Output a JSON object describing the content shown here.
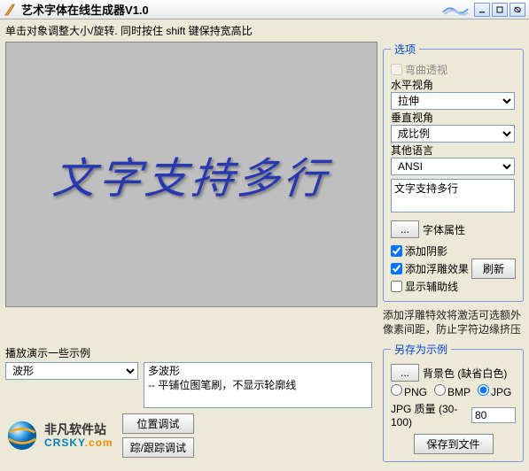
{
  "titlebar": {
    "title": "艺术字体在线生成器V1.0"
  },
  "hint": "单击对象调整大小/旋转.    同时按住 shift 键保持宽高比",
  "canvas": {
    "sample_text": "文字支持多行"
  },
  "options": {
    "legend": "选项",
    "curved_perspective": "弯曲透视",
    "h_label": "水平视角",
    "h_value": "拉伸",
    "v_label": "垂直视角",
    "v_value": "成比例",
    "lang_label": "其他语言",
    "lang_value": "ANSI",
    "text_value": "文字支持多行",
    "font_props_btn": "...",
    "font_props_label": "字体属性",
    "add_shadow": "添加阴影",
    "add_emboss": "添加浮雕效果",
    "refresh": "刷新",
    "show_guides": "显示辅助线",
    "note": "添加浮雕特效将激活可选额外像素间距，防止字符边缘挤压"
  },
  "demo": {
    "label": "播放演示一些示例",
    "select_value": "波形",
    "desc_title": "多波形",
    "desc_body": "  -- 平铺位图笔刷，不显示轮廓线"
  },
  "tests": {
    "pos": "位置调试",
    "track": "踪/跟踪调试"
  },
  "logo": {
    "cn": "非凡软件站",
    "en_main": "CRSKY",
    "en_suffix": ".com"
  },
  "saveas": {
    "legend": "另存为示例",
    "dots": "...",
    "bg_label": "背景色 (缺省白色)",
    "fmt_png": "PNG",
    "fmt_bmp": "BMP",
    "fmt_jpg": "JPG",
    "quality_label": "JPG 质量 (30-100)",
    "quality_value": "80",
    "save_btn": "保存到文件"
  }
}
